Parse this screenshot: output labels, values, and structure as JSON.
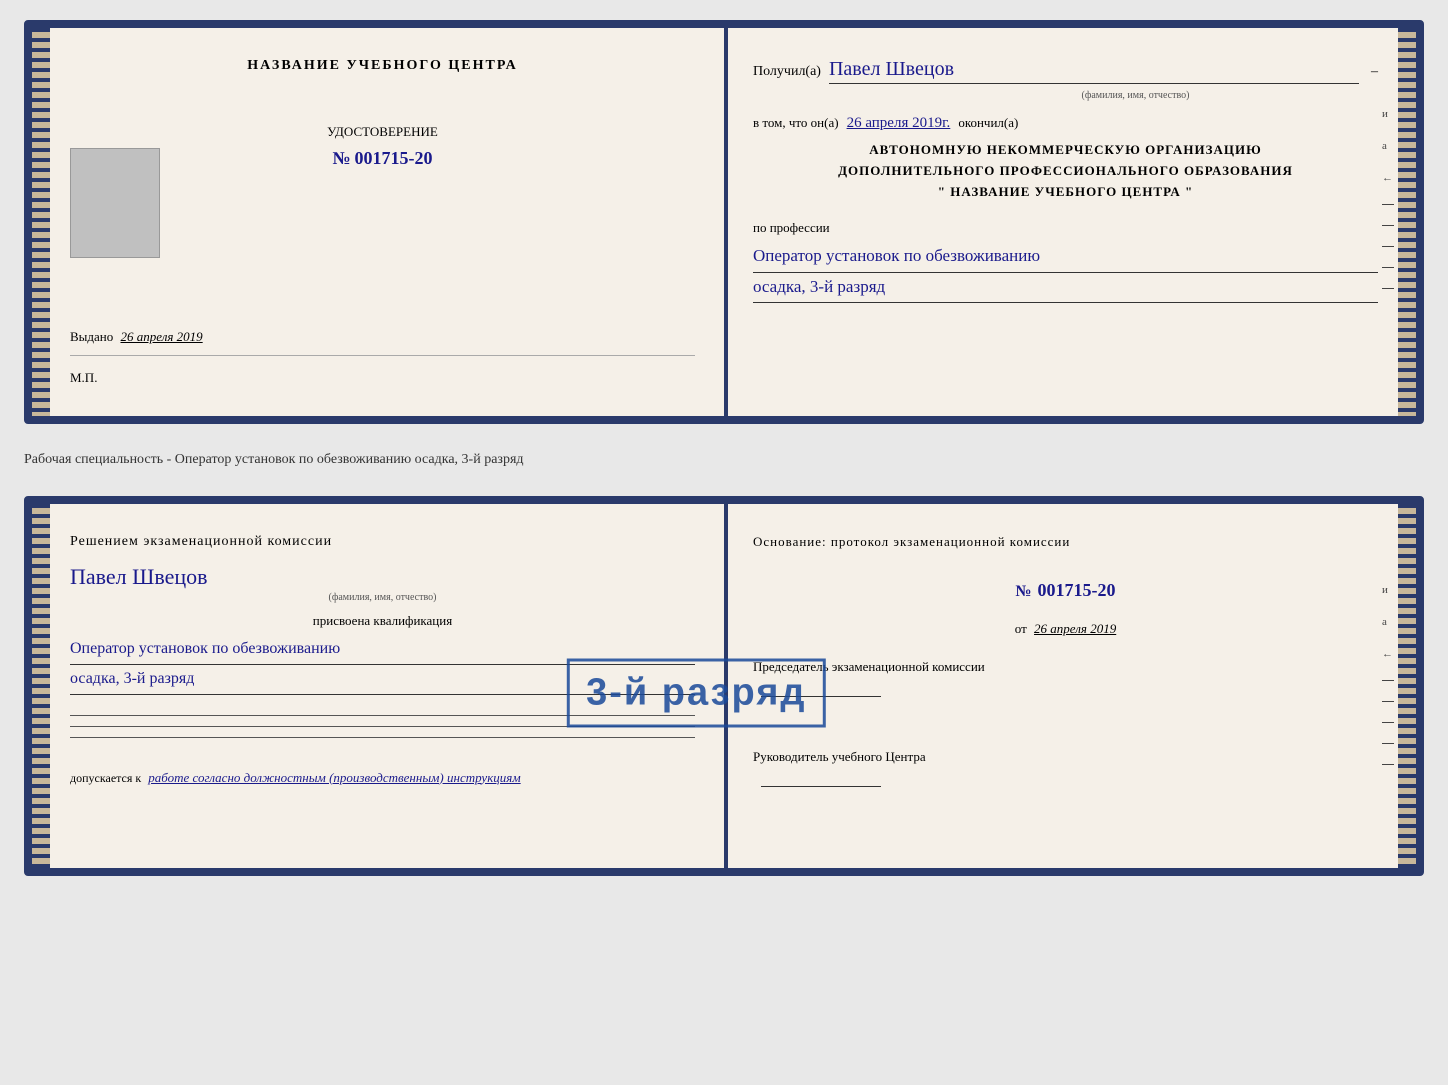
{
  "page": {
    "background": "#e8e8e8"
  },
  "separator": {
    "text": "Рабочая специальность - Оператор установок по обезвоживанию осадка, 3-й разряд"
  },
  "card1": {
    "left": {
      "title": "НАЗВАНИЕ УЧЕБНОГО ЦЕНТРА",
      "cert_label": "УДОСТОВЕРЕНИЕ",
      "cert_number_prefix": "№",
      "cert_number": "001715-20",
      "issued_prefix": "Выдано",
      "issued_date": "26 апреля 2019",
      "mp": "М.П."
    },
    "right": {
      "received_prefix": "Получил(а)",
      "recipient_name": "Павел Швецов",
      "name_sublabel": "(фамилия, имя, отчество)",
      "certified_prefix": "в том, что он(а)",
      "certified_date": "26 апреля 2019г.",
      "certified_suffix": "окончил(а)",
      "org_line1": "АВТОНОМНУЮ НЕКОММЕРЧЕСКУЮ ОРГАНИЗАЦИЮ",
      "org_line2": "ДОПОЛНИТЕЛЬНОГО ПРОФЕССИОНАЛЬНОГО ОБРАЗОВАНИЯ",
      "org_line3": "\"  НАЗВАНИЕ УЧЕБНОГО ЦЕНТРА  \"",
      "profession_label": "по профессии",
      "profession_line1": "Оператор установок по обезвоживанию",
      "profession_line2": "осадка, 3-й разряд"
    }
  },
  "card2": {
    "left": {
      "decision_title": "Решением экзаменационной комиссии",
      "name": "Павел Швецов",
      "name_sublabel": "(фамилия, имя, отчество)",
      "qualification_label": "присвоена квалификация",
      "qualification_line1": "Оператор установок по обезвоживанию",
      "qualification_line2": "осадка, 3-й разряд",
      "allowed_prefix": "допускается к",
      "allowed_text": "работе согласно должностным (производственным) инструкциям"
    },
    "right": {
      "basis_title": "Основание: протокол экзаменационной комиссии",
      "protocol_prefix": "№",
      "protocol_number": "001715-20",
      "date_prefix": "от",
      "date_value": "26 апреля 2019",
      "chairman_label": "Председатель экзаменационной комиссии",
      "director_label": "Руководитель учебного Центра"
    },
    "stamp": {
      "text": "3-й разряд"
    }
  },
  "vertical_chars": {
    "card1": "и а ←",
    "card2": "и а ←"
  }
}
